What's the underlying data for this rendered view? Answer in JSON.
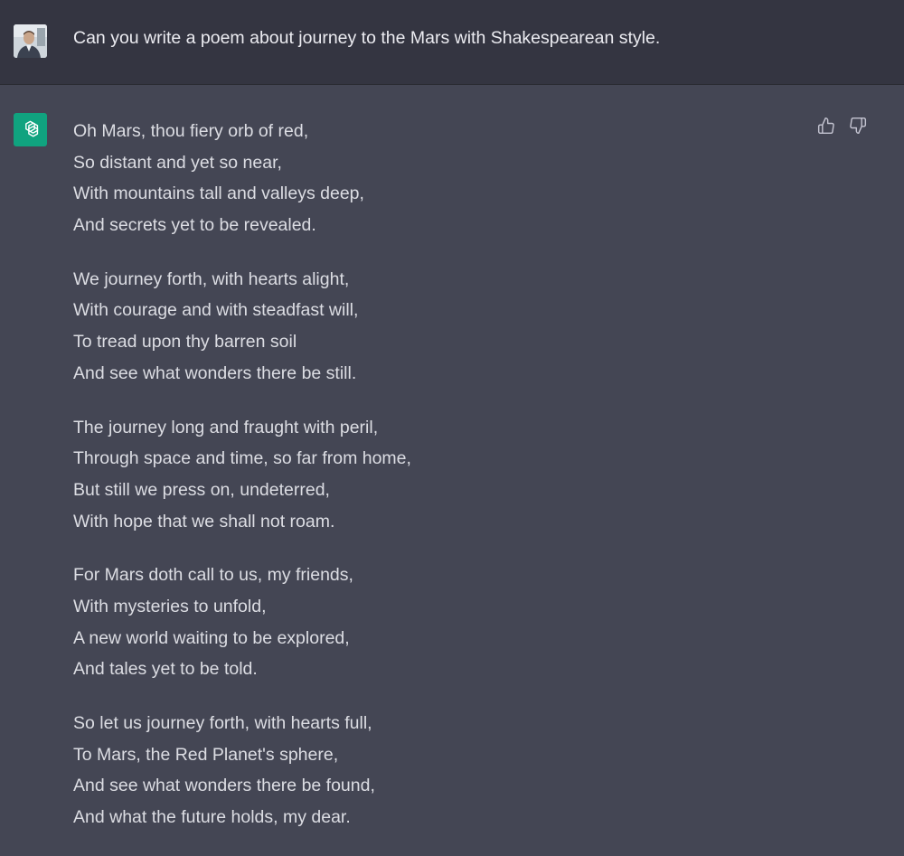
{
  "user": {
    "avatar_icon": "user-avatar-photo",
    "message": "Can you write a poem about journey to the Mars with Shakespearean style."
  },
  "assistant": {
    "avatar_icon": "openai-logo-icon",
    "accent_color": "#10a37f",
    "poem": [
      [
        "Oh Mars, thou fiery orb of red,",
        "So distant and yet so near,",
        "With mountains tall and valleys deep,",
        "And secrets yet to be revealed."
      ],
      [
        "We journey forth, with hearts alight,",
        "With courage and with steadfast will,",
        "To tread upon thy barren soil",
        "And see what wonders there be still."
      ],
      [
        "The journey long and fraught with peril,",
        "Through space and time, so far from home,",
        "But still we press on, undeterred,",
        "With hope that we shall not roam."
      ],
      [
        "For Mars doth call to us, my friends,",
        "With mysteries to unfold,",
        "A new world waiting to be explored,",
        "And tales yet to be told."
      ],
      [
        "So let us journey forth, with hearts full,",
        "To Mars, the Red Planet's sphere,",
        "And see what wonders there be found,",
        "And what the future holds, my dear."
      ]
    ],
    "feedback": {
      "thumbs_up_icon": "thumbs-up-icon",
      "thumbs_down_icon": "thumbs-down-icon"
    }
  },
  "colors": {
    "user_row_bg": "#343541",
    "assistant_row_bg": "#444654",
    "text": "#ececf1"
  }
}
